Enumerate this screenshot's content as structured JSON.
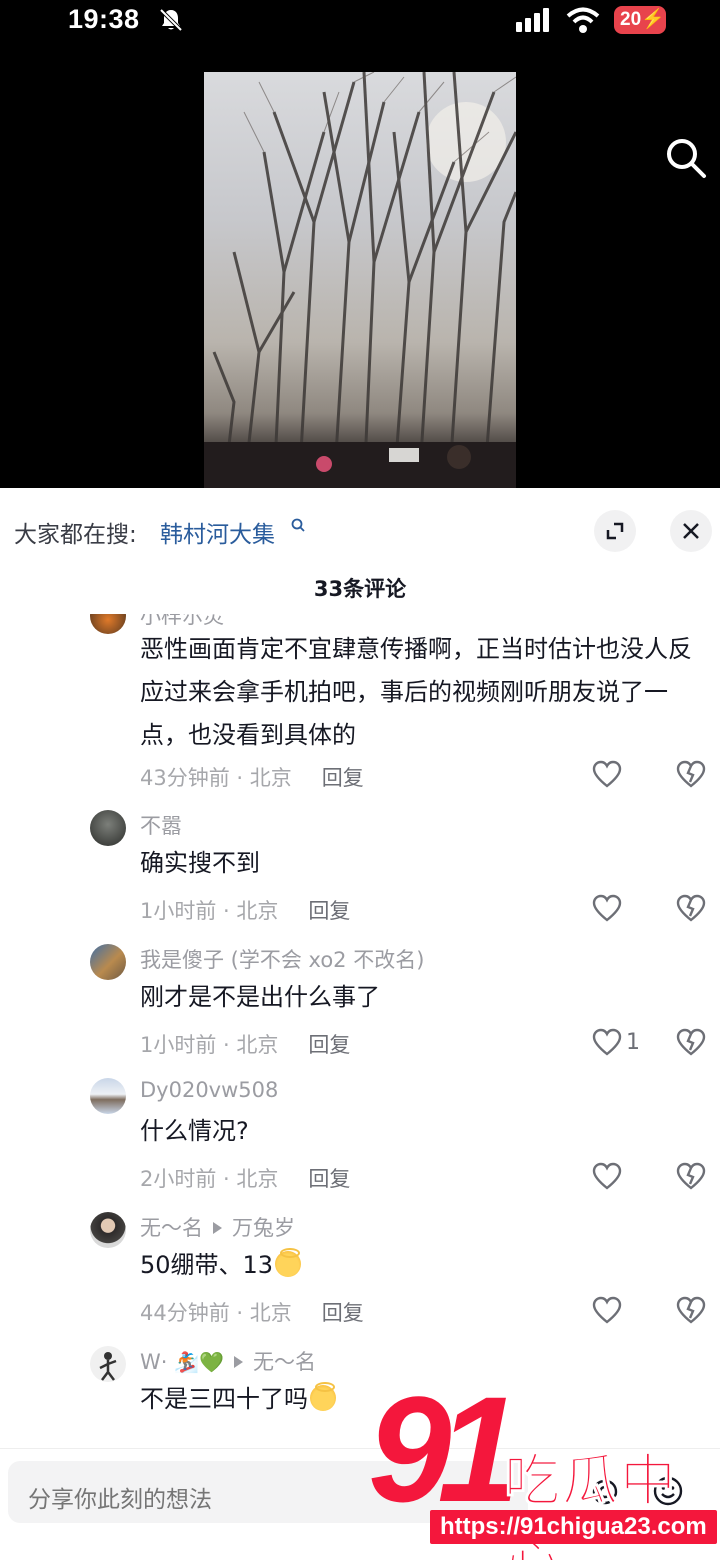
{
  "status_bar": {
    "time": "19:38",
    "battery": "20"
  },
  "search": {
    "prefix": "大家都在搜:",
    "term": "韩村河大集"
  },
  "comment_count": "33条评论",
  "comments": [
    {
      "username": "小样尔灵",
      "reply_to": "",
      "body": "恶性画面肯定不宜肆意传播啊，正当时估计也没人反应过来会拿手机拍吧，事后的视频刚听朋友说了一点，也没看到具体的",
      "time": "43分钟前 · 北京",
      "reply": "回复",
      "likes": "",
      "emoji": false
    },
    {
      "username": "不嚣",
      "reply_to": "",
      "body": "确实搜不到",
      "time": "1小时前 · 北京",
      "reply": "回复",
      "likes": "",
      "emoji": false
    },
    {
      "username": "我是傻子 (学不会 xo2 不改名)",
      "reply_to": "",
      "body": "刚才是不是出什么事了",
      "time": "1小时前 · 北京",
      "reply": "回复",
      "likes": "1",
      "emoji": false
    },
    {
      "username": "Dy020vw508",
      "reply_to": "",
      "body": "什么情况?",
      "time": "2小时前 · 北京",
      "reply": "回复",
      "likes": "",
      "emoji": false
    },
    {
      "username": "无～名",
      "reply_to": "万兔岁",
      "body": "50绷带、13",
      "time": "44分钟前 · 北京",
      "reply": "回复",
      "likes": "",
      "emoji": true
    },
    {
      "username": "W·",
      "reply_to": "无～名",
      "body": "不是三四十了吗",
      "time": "",
      "reply": "",
      "likes": "",
      "emoji": true
    }
  ],
  "input": {
    "placeholder": "分享你此刻的想法"
  },
  "watermark": {
    "number": "91",
    "name": "吃瓜中心",
    "url": "https://91chigua23.com"
  },
  "colors": {
    "accent_link": "#2a5c9c",
    "battery": "#e8434c",
    "watermark": "#f4173c"
  }
}
